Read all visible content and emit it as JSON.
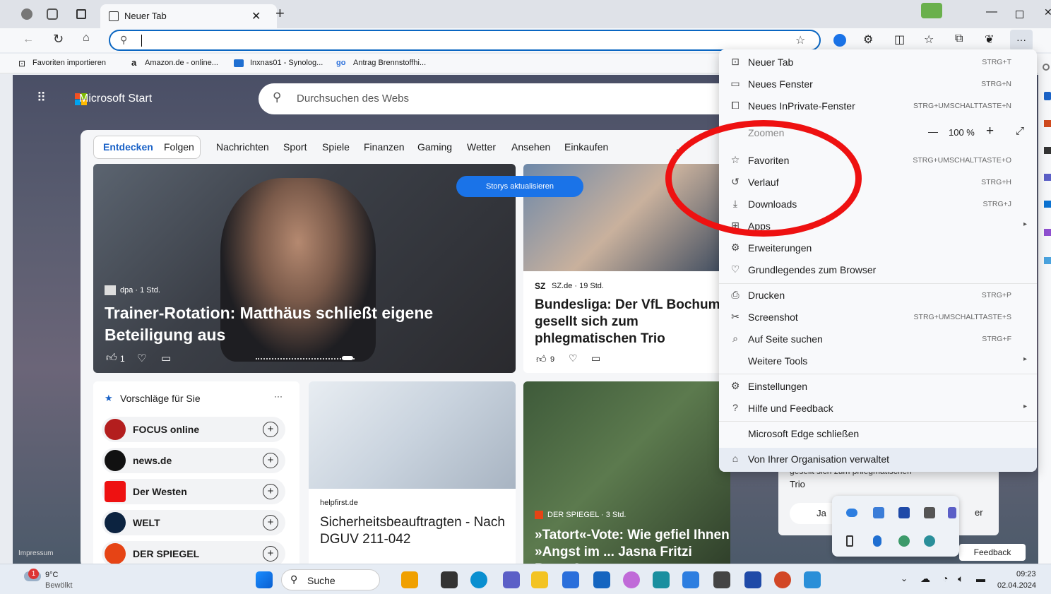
{
  "browser": {
    "tab_title": "Neuer Tab",
    "new_tab_plus": "+",
    "url_placeholder": "",
    "favorites": [
      {
        "label": "Favoriten importieren"
      },
      {
        "label": "Amazon.de - online..."
      },
      {
        "label": "Inxnas01 - Synolog..."
      },
      {
        "label": "Antrag Brennstoffhi..."
      }
    ],
    "more_button": "···"
  },
  "start": {
    "brand": "Microsoft Start",
    "search_placeholder": "Durchsuchen des Webs",
    "nav": [
      "Entdecken",
      "Folgen",
      "Nachrichten",
      "Sport",
      "Spiele",
      "Finanzen",
      "Gaming",
      "Wetter",
      "Ansehen",
      "Einkaufen"
    ],
    "nav_more": "...",
    "refresh_button": "Storys aktualisieren",
    "hero": {
      "source": "dpa · 1 Std.",
      "title": "Trainer-Rotation: Matthäus schließt eigene Beteiligung aus",
      "likes": "1"
    },
    "card2": {
      "source": "SZ.de · 19 Std.",
      "title": "Bundesliga: Der VfL Bochum gesellt sich zum phlegmatischen Trio",
      "likes": "9"
    },
    "suggest": {
      "heading": "Vorschläge für Sie",
      "more": "···",
      "items": [
        {
          "name": "FOCUS online"
        },
        {
          "name": "news.de"
        },
        {
          "name": "Der Westen"
        },
        {
          "name": "WELT"
        },
        {
          "name": "DER SPIEGEL"
        }
      ]
    },
    "card3": {
      "source": "helpfirst.de",
      "title": "Sicherheitsbeauftragten - Nach DGUV 211-042"
    },
    "card4": {
      "source": "DER SPIEGEL · 3 Std.",
      "title": "»Tatort«-Vote: Wie gefiel Ihnen »Angst im ... Jasna Fritzi Bauer?"
    },
    "popup": {
      "text1": "gesellt sich zum phlegmatischen",
      "text2": "Trio",
      "yes": "Ja",
      "er": "er"
    },
    "feedback": "Feedback",
    "impressum": "Impressum"
  },
  "menu": {
    "items": [
      {
        "label": "Neuer Tab",
        "shortcut": "STRG+T",
        "icon": "new-tab-icon"
      },
      {
        "label": "Neues Fenster",
        "shortcut": "STRG+N",
        "icon": "window-icon"
      },
      {
        "label": "Neues InPrivate-Fenster",
        "shortcut": "STRG+UMSCHALTTASTE+N",
        "icon": "inprivate-icon"
      },
      {
        "label": "Zoomen",
        "shortcut": "",
        "icon": "zoom-icon"
      },
      {
        "label": "Favoriten",
        "shortcut": "STRG+UMSCHALTTASTE+O",
        "icon": "favorites-icon"
      },
      {
        "label": "Verlauf",
        "shortcut": "STRG+H",
        "icon": "history-icon"
      },
      {
        "label": "Downloads",
        "shortcut": "STRG+J",
        "icon": "download-icon"
      },
      {
        "label": "Apps",
        "shortcut": "",
        "icon": "apps-icon"
      },
      {
        "label": "Erweiterungen",
        "shortcut": "",
        "icon": "extensions-icon"
      },
      {
        "label": "Grundlegendes zum Browser",
        "shortcut": "",
        "icon": "heart-icon"
      },
      {
        "label": "Drucken",
        "shortcut": "STRG+P",
        "icon": "print-icon"
      },
      {
        "label": "Screenshot",
        "shortcut": "STRG+UMSCHALTTASTE+S",
        "icon": "screenshot-icon"
      },
      {
        "label": "Auf Seite suchen",
        "shortcut": "STRG+F",
        "icon": "find-icon"
      },
      {
        "label": "Weitere Tools",
        "shortcut": "",
        "icon": ""
      },
      {
        "label": "Einstellungen",
        "shortcut": "",
        "icon": "settings-icon"
      },
      {
        "label": "Hilfe und Feedback",
        "shortcut": "",
        "icon": "help-icon"
      },
      {
        "label": "Microsoft Edge schließen",
        "shortcut": "",
        "icon": ""
      },
      {
        "label": "Von Ihrer Organisation verwaltet",
        "shortcut": "",
        "icon": "managed-icon"
      }
    ],
    "zoom_minus": "—",
    "zoom_value": "100 %",
    "zoom_plus": "+",
    "accent": "#ee1111"
  },
  "taskbar": {
    "weather_temp": "9°C",
    "weather_desc": "Bewölkt",
    "weather_badge": "1",
    "search": "Suche",
    "time": "09:23",
    "date": "02.04.2024"
  }
}
